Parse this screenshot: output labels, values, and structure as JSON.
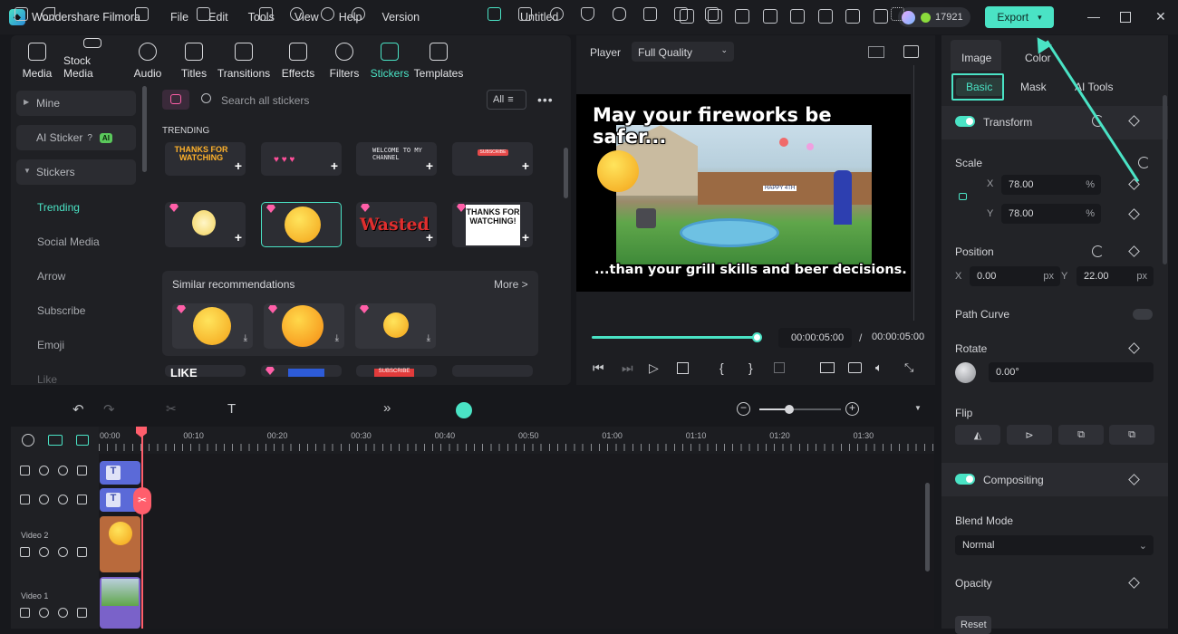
{
  "app": {
    "name": "Wondershare Filmora",
    "doc_title": "Untitled",
    "credits": "17921",
    "export_label": "Export"
  },
  "menu": [
    "File",
    "Edit",
    "Tools",
    "View",
    "Help",
    "Version"
  ],
  "media_tabs": [
    {
      "label": "Media",
      "icon": "media-icon"
    },
    {
      "label": "Stock Media",
      "icon": "stock-media-icon"
    },
    {
      "label": "Audio",
      "icon": "audio-icon"
    },
    {
      "label": "Titles",
      "icon": "titles-icon"
    },
    {
      "label": "Transitions",
      "icon": "transitions-icon"
    },
    {
      "label": "Effects",
      "icon": "effects-icon"
    },
    {
      "label": "Filters",
      "icon": "filters-icon"
    },
    {
      "label": "Stickers",
      "icon": "stickers-icon",
      "active": true
    },
    {
      "label": "Templates",
      "icon": "templates-icon"
    }
  ],
  "sidebar": {
    "mine": "Mine",
    "ai_sticker": "AI Sticker",
    "ai_badge": "AI",
    "stickers": "Stickers",
    "subitems": [
      "Trending",
      "Social Media",
      "Arrow",
      "Subscribe",
      "Emoji",
      "Like"
    ]
  },
  "stickers": {
    "search_placeholder": "Search all stickers",
    "filter": "All",
    "section": "TRENDING",
    "row1": [
      "THANKS FOR WATCHING",
      "",
      "WELCOME TO MY CHANNEL",
      "SUBSCRIBE"
    ],
    "row2_labels": {
      "wasted": "Wasted",
      "thanks": "THANKS FOR WATCHING!"
    },
    "similar_title": "Similar recommendations",
    "more": "More >",
    "row4": [
      "LIKE",
      "",
      "SUBSCRIBE",
      ""
    ]
  },
  "player": {
    "label": "Player",
    "quality": "Full Quality",
    "caption_top": "May your fireworks be safer...",
    "caption_bottom": "...than your grill skills and beer decisions.",
    "current_time": "00:00:05:00",
    "separator": "/",
    "total_time": "00:00:05:00",
    "progress": 1.0,
    "scene_sign": "HAPPY 4TH"
  },
  "properties": {
    "tabs": [
      "Image",
      "Color"
    ],
    "subtabs": [
      "Basic",
      "Mask",
      "AI Tools"
    ],
    "transform": "Transform",
    "scale": "Scale",
    "scale_x_label": "X",
    "scale_x": "78.00",
    "scale_y_label": "Y",
    "scale_y": "78.00",
    "pct": "%",
    "position": "Position",
    "pos_x_label": "X",
    "pos_x": "0.00",
    "pos_y_label": "Y",
    "pos_y": "22.00",
    "px": "px",
    "path_curve": "Path Curve",
    "rotate": "Rotate",
    "rotate_value": "0.00°",
    "flip": "Flip",
    "compositing": "Compositing",
    "blend_mode": "Blend Mode",
    "blend_value": "Normal",
    "opacity": "Opacity",
    "reset": "Reset"
  },
  "timeline": {
    "ticks": [
      "00:00",
      "00:10",
      "00:20",
      "00:30",
      "00:40",
      "00:50",
      "01:00",
      "01:10",
      "01:20",
      "01:30"
    ],
    "tracks": [
      "",
      "",
      "Video 2",
      "Video 1"
    ],
    "title_clip": "T"
  },
  "colors": {
    "accent": "#4ae3c5",
    "playhead": "#ff5e6c",
    "title_clip": "#5b6ad8"
  }
}
